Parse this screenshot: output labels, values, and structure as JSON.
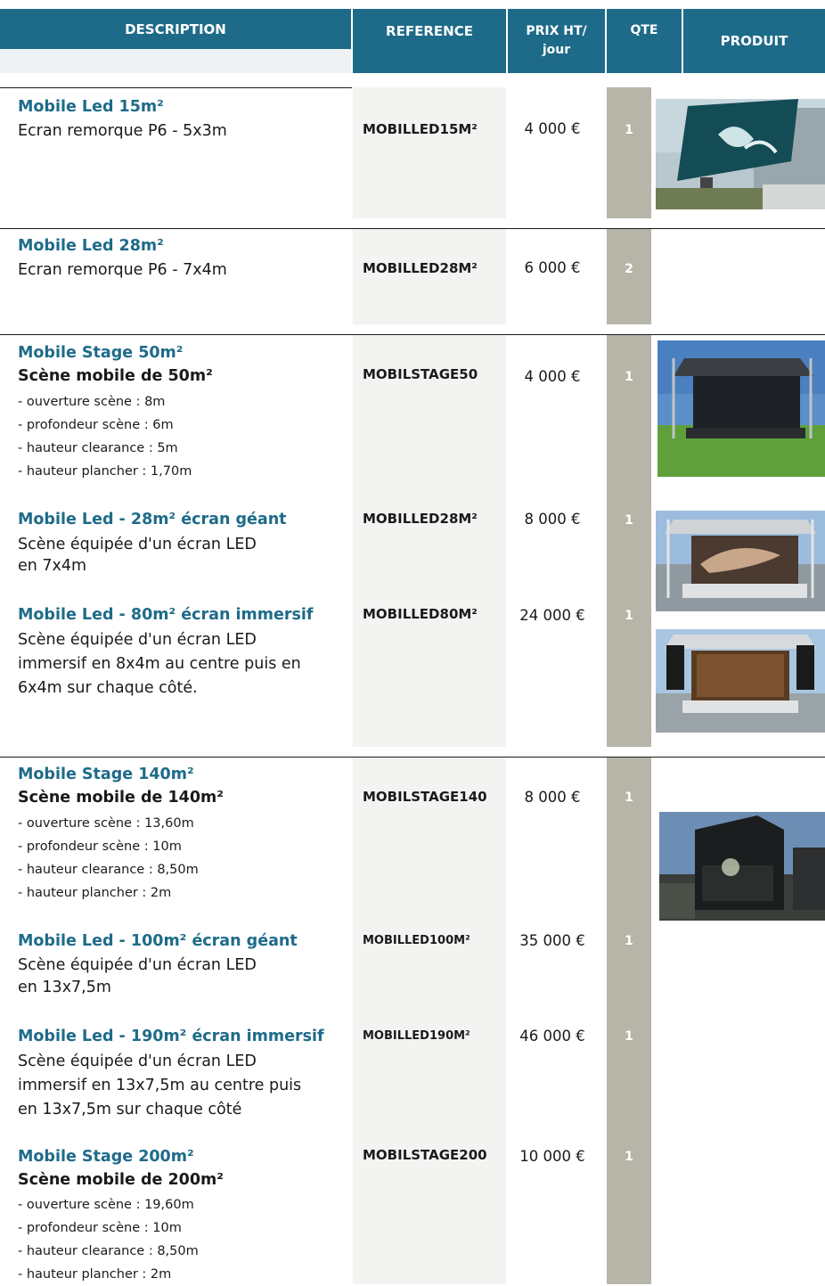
{
  "header": {
    "description": "DESCRIPTION",
    "reference": "REFERENCE",
    "price_line1": "PRIX HT/",
    "price_line2": "jour",
    "qte": "QTE",
    "produit": "PRODUIT"
  },
  "colors": {
    "accent": "#1e6b89",
    "qte_column": "#b7b5a8",
    "ref_column": "#f3f3f2"
  },
  "items": [
    {
      "title": "Mobile Led 15m²",
      "subtitle": "Ecran remorque P6 - 5x3m",
      "ref": "MOBILLED15M²",
      "price": "4 000 €",
      "qty": "1"
    },
    {
      "title": "Mobile Led 28m²",
      "subtitle": "Ecran remorque P6 - 7x4m",
      "ref": "MOBILLED28M²",
      "price": "6 000 €",
      "qty": "2"
    },
    {
      "title": "Mobile Stage 50m²",
      "bold_sub": "Scène mobile de 50m²",
      "specs": [
        "- ouverture scène : 8m",
        "- profondeur scène : 6m",
        "- hauteur clearance : 5m",
        "- hauteur plancher : 1,70m"
      ],
      "ref": "MOBILSTAGE50",
      "price": "4 000 €",
      "qty": "1"
    },
    {
      "title": "Mobile Led - 28m² écran géant",
      "desc_lines": [
        "Scène équipée d'un écran LED",
        "en 7x4m"
      ],
      "ref": "MOBILLED28M²",
      "price": "8 000 €",
      "qty": "1"
    },
    {
      "title": "Mobile Led - 80m² écran immersif",
      "desc_lines": [
        "Scène équipée d'un écran LED",
        "immersif en 8x4m au centre puis en",
        "6x4m sur chaque côté."
      ],
      "ref": "MOBILLED80M²",
      "price": "24 000 €",
      "qty": "1"
    },
    {
      "title": "Mobile Stage 140m²",
      "bold_sub": "Scène mobile de 140m²",
      "specs": [
        "- ouverture scène : 13,60m",
        "- profondeur scène : 10m",
        "- hauteur clearance : 8,50m",
        "- hauteur plancher : 2m"
      ],
      "ref": "MOBILSTAGE140",
      "price": "8 000 €",
      "qty": "1"
    },
    {
      "title": "Mobile Led - 100m² écran géant",
      "desc_lines": [
        "Scène équipée d'un écran LED",
        "en 13x7,5m"
      ],
      "ref": "MOBILLED100M²",
      "price": "35 000 €",
      "qty": "1"
    },
    {
      "title": "Mobile Led - 190m² écran immersif",
      "desc_lines": [
        "Scène équipée d'un écran LED",
        "immersif en 13x7,5m au centre puis",
        "en 13x7,5m sur chaque côté"
      ],
      "ref": "MOBILLED190M²",
      "price": "46 000 €",
      "qty": "1"
    },
    {
      "title": "Mobile Stage 200m²",
      "bold_sub": "Scène mobile de 200m²",
      "specs": [
        "- ouverture scène : 19,60m",
        "- profondeur scène : 10m",
        "- hauteur clearance : 8,50m",
        "- hauteur plancher : 2m"
      ],
      "ref": "MOBILSTAGE200",
      "price": "10 000 €",
      "qty": "1"
    }
  ]
}
